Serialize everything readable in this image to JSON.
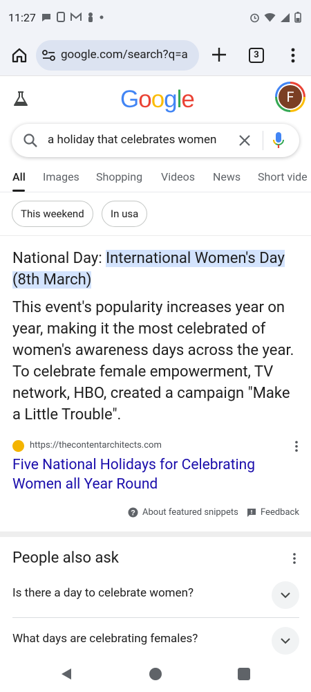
{
  "status_bar": {
    "time": "11:27"
  },
  "browser": {
    "url": "google.com/search?q=a",
    "tab_count": "3"
  },
  "google_logo": [
    {
      "ch": "G",
      "color": "#4285f4"
    },
    {
      "ch": "o",
      "color": "#ea4335"
    },
    {
      "ch": "o",
      "color": "#fbbc05"
    },
    {
      "ch": "g",
      "color": "#4285f4"
    },
    {
      "ch": "l",
      "color": "#34a853"
    },
    {
      "ch": "e",
      "color": "#ea4335"
    }
  ],
  "account": {
    "avatar_letter": "F"
  },
  "search": {
    "query": "a holiday that celebrates women"
  },
  "nav_tabs": [
    "All",
    "Images",
    "Shopping",
    "Videos",
    "News",
    "Short vide"
  ],
  "filter_chips": [
    "This weekend",
    "In usa"
  ],
  "snippet": {
    "heading_prefix": "National Day: ",
    "heading_highlight": "International Women's Day (8th March)",
    "body": "This event's popularity increases year on year, making it the most celebrated of women's awareness days across the year. To celebrate female empowerment, TV network, HBO, created a campaign \"Make a Little Trouble\".",
    "source_url": "https://thecontentarchitects.com",
    "result_title": "Five National Holidays for Celebrating Women all Year Round"
  },
  "meta": {
    "about": "About featured snippets",
    "feedback": "Feedback"
  },
  "people_also_ask": {
    "title": "People also ask",
    "questions": [
      "Is there a day to celebrate women?",
      "What days are celebrating females?"
    ]
  },
  "colors": {
    "link": "#1a0dab",
    "highlight": "#d3e3fd",
    "browser_bar": "#f1f3f8",
    "url_pill": "#dce3f1"
  }
}
